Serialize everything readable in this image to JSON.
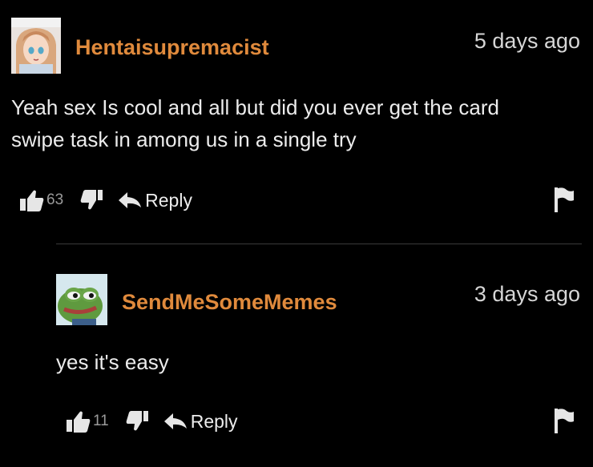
{
  "comments": [
    {
      "username": "Hentaisupremacist",
      "timestamp": "5 days ago",
      "body_lines": [
        "Yeah sex Is cool and all but did you ever get the card",
        "swipe task in among us in a single try"
      ],
      "upvotes": "63",
      "reply_label": "Reply",
      "avatar_icon": "anime-girl-avatar-icon"
    },
    {
      "username": "SendMeSomeMemes",
      "timestamp": "3 days ago",
      "body_lines": [
        "yes it's easy"
      ],
      "upvotes": "11",
      "reply_label": "Reply",
      "avatar_icon": "pepe-frog-avatar-icon"
    }
  ],
  "colors": {
    "background": "#000000",
    "username": "#e08a3c",
    "text": "#ececec",
    "muted_count": "#9a9a9a",
    "icon": "#e6e6e6"
  }
}
